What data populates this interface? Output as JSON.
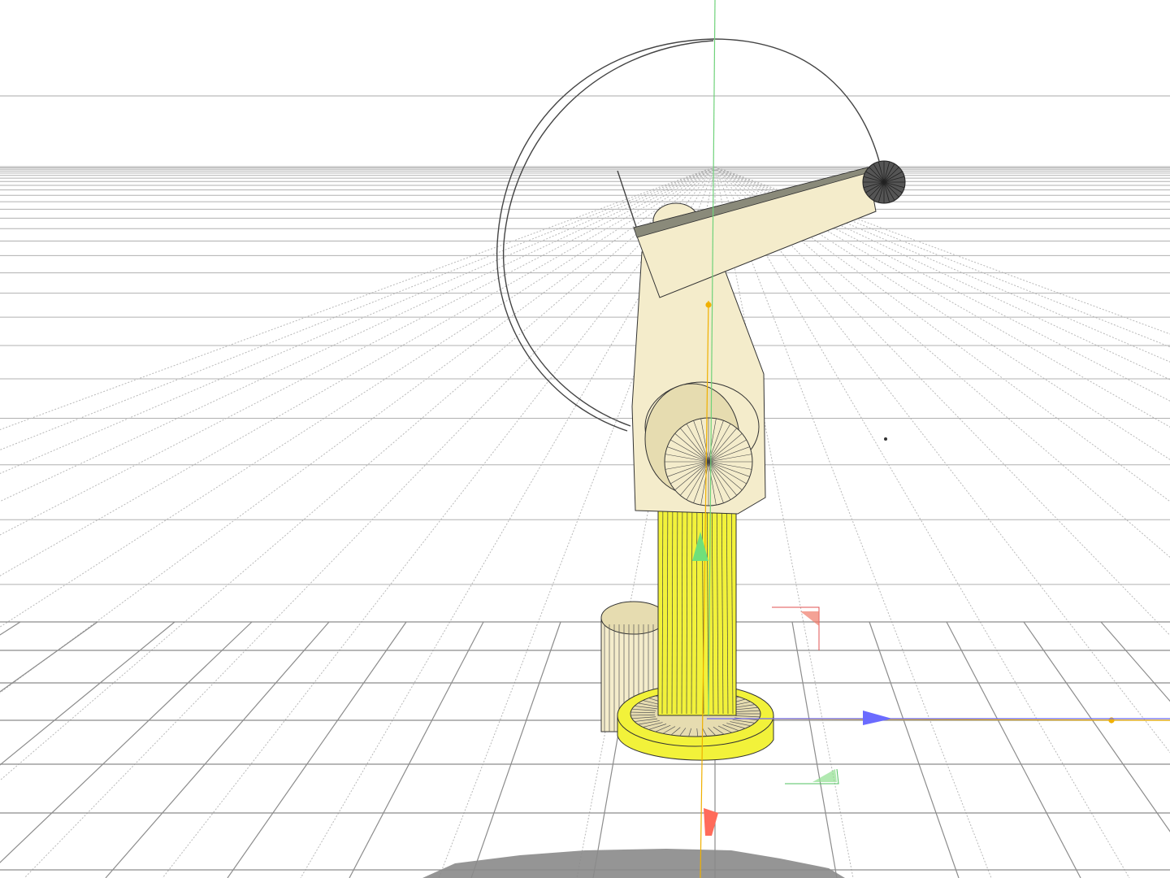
{
  "viewport": {
    "background": "#ffffff",
    "overlay_text": ""
  },
  "colors": {
    "grid_line": "#9a9a9a",
    "grid_line_far": "#b8b8b8",
    "object_cream": "#f4eccb",
    "object_cream_shade": "#e6dcb0",
    "object_yellow": "#f2f23a",
    "object_yellow_shade": "#d9d920",
    "wire": "#333333",
    "gizmo_x": "#6b6bff",
    "gizmo_y": "#6fe07a",
    "gizmo_z": "#ff6b5a",
    "pivot_axis": "#f0b000",
    "shadow": "#8a8a8a"
  },
  "scene_objects": [
    {
      "name": "base-disc",
      "kind": "cylinder"
    },
    {
      "name": "main-column",
      "kind": "cylinder"
    },
    {
      "name": "side-cylinder",
      "kind": "cylinder"
    },
    {
      "name": "upper-arm",
      "kind": "box"
    },
    {
      "name": "shoulder-joint",
      "kind": "cylinder"
    },
    {
      "name": "forearm",
      "kind": "box"
    },
    {
      "name": "elbow-joint",
      "kind": "cylinder"
    },
    {
      "name": "end-effector",
      "kind": "sphere"
    },
    {
      "name": "rotation-circle",
      "kind": "spline"
    }
  ],
  "gizmo": {
    "x_icon": "arrow-right-icon",
    "y_icon": "arrow-up-icon",
    "z_icon": "arrow-down-icon"
  }
}
